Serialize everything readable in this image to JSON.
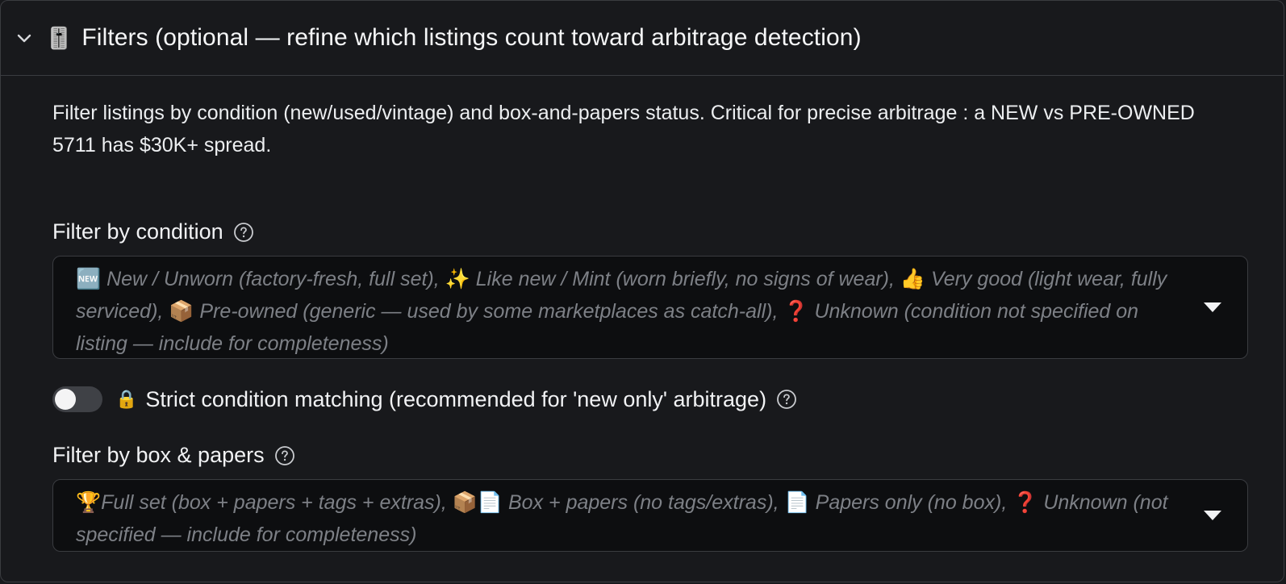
{
  "header": {
    "emoji": "🎚️",
    "title": "Filters (optional — refine which listings count toward arbitrage detection)"
  },
  "description": "Filter listings by condition (new/used/vintage) and box-and-papers status. Critical for precise arbitrage : a NEW vs PRE-OWNED 5711 has $30K+ spread.",
  "condition": {
    "label": "Filter by condition",
    "options": [
      {
        "emoji": "🆕",
        "text": "New / Unworn (factory-fresh, full set),"
      },
      {
        "emoji": "✨",
        "text": "Like new / Mint (worn briefly, no signs of wear),"
      },
      {
        "emoji": "👍",
        "text": "Very good (light wear, fully serviced),"
      },
      {
        "emoji": "📦",
        "text": "Pre-owned (generic — used by some marketplaces as catch-all),"
      },
      {
        "emoji": "❓",
        "text": "Unknown (condition not specified on listing — include for completeness)"
      }
    ]
  },
  "strict_toggle": {
    "emoji": "🔒",
    "label": "Strict condition matching (recommended for 'new only' arbitrage)",
    "enabled": false
  },
  "box_papers": {
    "label": "Filter by box & papers",
    "options": [
      {
        "emoji": "🏆",
        "text": "Full set (box + papers + tags + extras),"
      },
      {
        "emoji": "📦📄",
        "text": "Box + papers (no tags/extras),"
      },
      {
        "emoji": "📄",
        "text": "Papers only (no box),"
      },
      {
        "emoji": "❓",
        "text": "Unknown (not specified — include for completeness)"
      }
    ]
  },
  "colors": {
    "background": "#18191c",
    "input_background": "#0d0e10",
    "border": "#3a3c40",
    "placeholder_text": "#7d8086"
  }
}
